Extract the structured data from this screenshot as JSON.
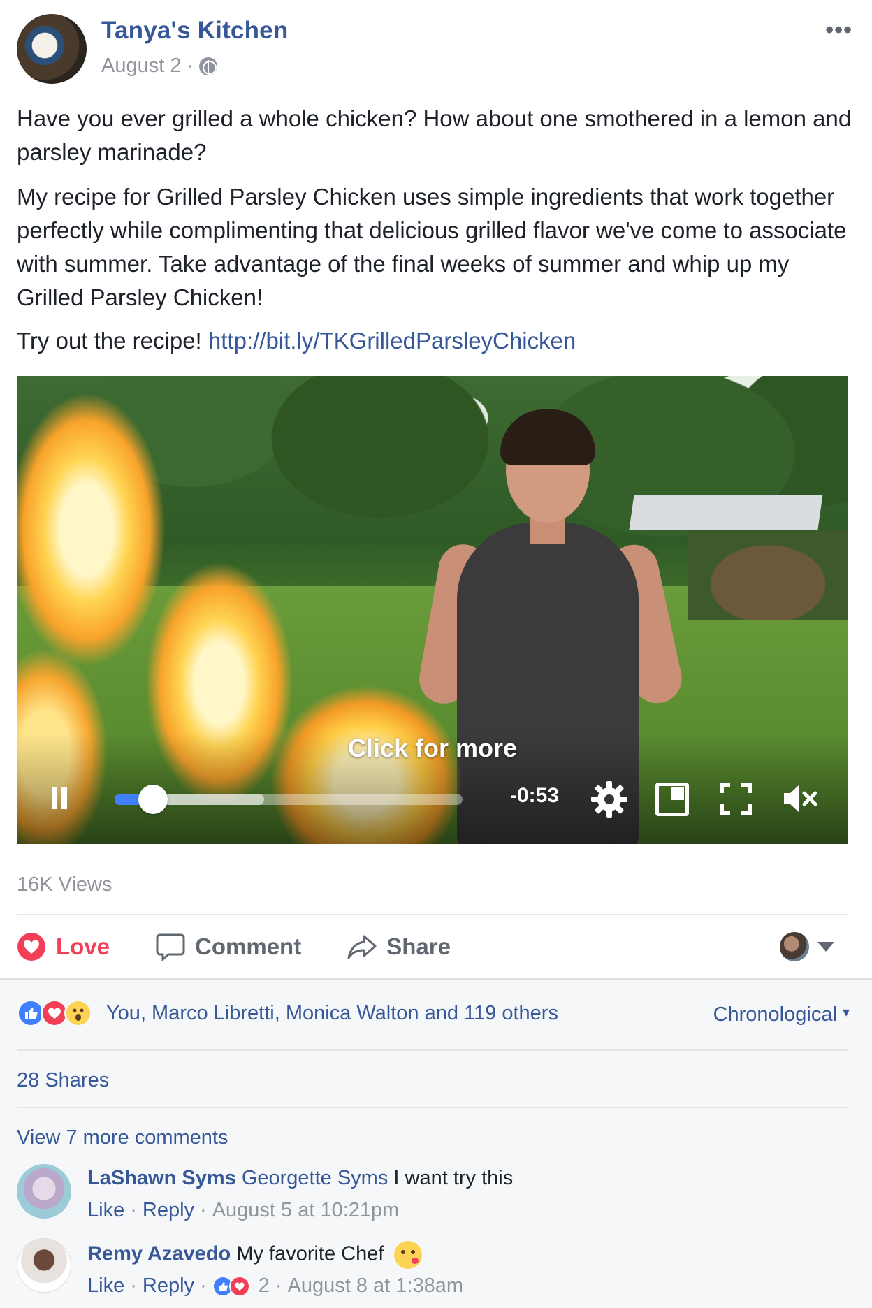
{
  "post": {
    "author": "Tanya's Kitchen",
    "date": "August 2",
    "separator": "·",
    "more_label": "•••",
    "paragraph1": "Have you ever grilled a whole chicken? How about one smothered in a lemon and parsley marinade?",
    "paragraph2": "My recipe for Grilled Parsley Chicken uses simple ingredients that work together perfectly while complimenting that delicious grilled flavor we've come to associate with summer. Take advantage of the final weeks of summer and whip up my Grilled Parsley Chicken!",
    "paragraph3_prefix": "Try out the recipe! ",
    "link": "http://bit.ly/TKGrilledParsleyChicken"
  },
  "video": {
    "overlay_text": "Click for more",
    "time_remaining": "-0:53",
    "progress_played": 0.11,
    "progress_buffered": 0.43
  },
  "views": "16K Views",
  "actions": {
    "love": "Love",
    "comment": "Comment",
    "share": "Share"
  },
  "reactions": {
    "summary": "You, Marco Libretti, Monica Walton and 119 others",
    "sort": "Chronological",
    "sort_caret": "▾"
  },
  "shares": "28 Shares",
  "view_more": "View 7 more comments",
  "comments": [
    {
      "name": "LaShawn Syms",
      "tag": "Georgette Syms",
      "text": "I want try this",
      "like": "Like",
      "reply": "Reply",
      "dot": "·",
      "time": "August 5 at 10:21pm"
    },
    {
      "name": "Remy Azavedo",
      "text": "My favorite Chef",
      "like": "Like",
      "reply": "Reply",
      "dot": "·",
      "reaction_count": "2",
      "time": "August 8 at 1:38am"
    }
  ],
  "colors": {
    "link": "#365899",
    "love": "#f33e58",
    "like_blue": "#4080ff",
    "muted": "#90949c"
  }
}
